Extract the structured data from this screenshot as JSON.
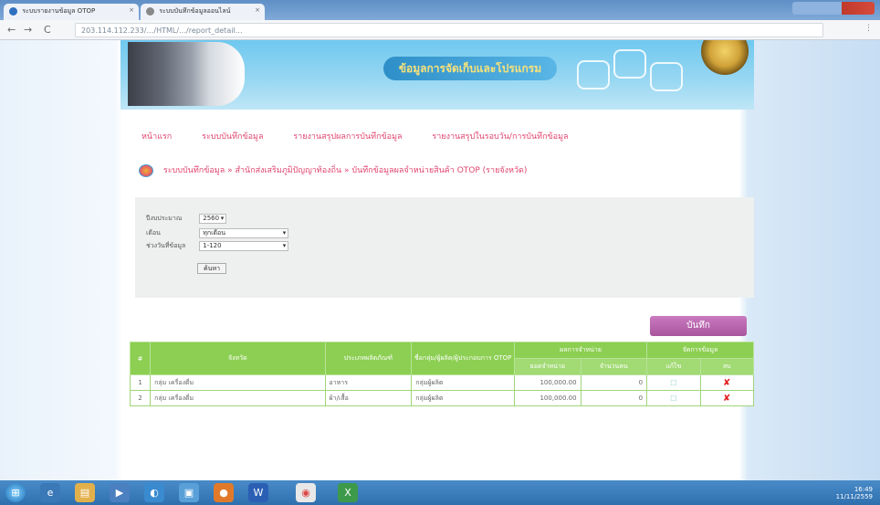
{
  "browser": {
    "tabs": [
      {
        "label": "ระบบรายงานข้อมูล OTOP"
      },
      {
        "label": "ระบบบันทึกข้อมูลออนไลน์"
      }
    ],
    "url": "203.114.112.233/…/HTML/…/report_detail…",
    "zoom": "⋮"
  },
  "banner": {
    "title": "ข้อมูลการจัดเก็บและโปรแกรม"
  },
  "menu": {
    "items": [
      "หน้าแรก",
      "ระบบบันทึกข้อมูล",
      "รายงานสรุปผลการบันทึกข้อมูล",
      "รายงานสรุปในรอบวัน/การบันทึกข้อมูล"
    ]
  },
  "breadcrumb": "ระบบบันทึกข้อมูล » สำนักส่งเสริมภูมิปัญญาท้องถิ่น » บันทึกข้อมูลผลจำหน่ายสินค้า OTOP (รายจังหวัด)",
  "filter": {
    "year_label": "ปีงบประมาณ",
    "year_value": "2560",
    "month_label": "เดือน",
    "month_value": "ทุกเดือน",
    "date_label": "ช่วงวันที่ข้อมูล",
    "date_value": "1-120",
    "search_button": "ค้นหา"
  },
  "add_button": "บันทึก",
  "table": {
    "headers": {
      "no": "#",
      "province": "จังหวัด",
      "district": "ประเภทผลิตภัณฑ์",
      "group": "ชื่อกลุ่ม/ผู้ผลิต/ผู้ประกอบการ OTOP",
      "amount_group": "ผลการจำหน่าย",
      "amount_1": "ยอดจำหน่าย",
      "amount_2": "จำนวนคน",
      "manage_group": "จัดการข้อมูล",
      "edit": "แก้ไข",
      "delete": "ลบ"
    },
    "rows": [
      {
        "no": "1",
        "province": "กลุ่ม เครื่องดื่ม",
        "district": "อาหาร",
        "group": "กลุ่มผู้ผลิต",
        "amount": "100,000.00",
        "count": "0"
      },
      {
        "no": "2",
        "province": "กลุ่ม เครื่องดื่ม",
        "district": "ผ้า/เสื้อ",
        "group": "กลุ่มผู้ผลิต",
        "amount": "100,000.00",
        "count": "0"
      }
    ]
  },
  "taskbar": {
    "time": "16:49",
    "date": "11/11/2559"
  },
  "colors": {
    "accent": "#e04470",
    "table_header": "#8ccf52",
    "button": "#a9559e"
  }
}
